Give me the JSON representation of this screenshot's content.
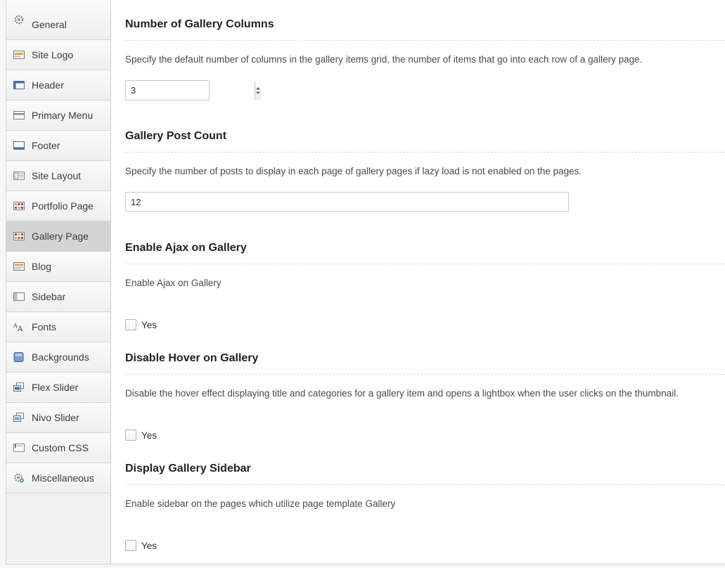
{
  "sidebar": {
    "items": [
      {
        "label": "General",
        "icon": "gear-icon"
      },
      {
        "label": "Site Logo",
        "icon": "logo-icon"
      },
      {
        "label": "Header",
        "icon": "header-icon"
      },
      {
        "label": "Primary Menu",
        "icon": "menu-icon"
      },
      {
        "label": "Footer",
        "icon": "footer-icon"
      },
      {
        "label": "Site Layout",
        "icon": "layout-icon"
      },
      {
        "label": "Portfolio Page",
        "icon": "portfolio-icon"
      },
      {
        "label": "Gallery Page",
        "icon": "gallery-icon",
        "active": true
      },
      {
        "label": "Blog",
        "icon": "blog-icon"
      },
      {
        "label": "Sidebar",
        "icon": "sidebar-icon"
      },
      {
        "label": "Fonts",
        "icon": "fonts-icon"
      },
      {
        "label": "Backgrounds",
        "icon": "backgrounds-icon"
      },
      {
        "label": "Flex Slider",
        "icon": "slider-icon"
      },
      {
        "label": "Nivo Slider",
        "icon": "slider-icon"
      },
      {
        "label": "Custom CSS",
        "icon": "css-icon"
      },
      {
        "label": "Miscellaneous",
        "icon": "misc-icon"
      }
    ]
  },
  "sections": {
    "columns": {
      "title": "Number of Gallery Columns",
      "description": "Specify the default number of columns in the gallery items grid, the number of items that go into each row of a gallery page.",
      "value": "3"
    },
    "post_count": {
      "title": "Gallery Post Count",
      "description": "Specify the number of posts to display in each page of gallery pages if lazy load is not enabled on the pages.",
      "value": "12"
    },
    "ajax": {
      "title": "Enable Ajax on Gallery",
      "description": "Enable Ajax on Gallery",
      "checkbox_label": "Yes",
      "checked": false
    },
    "hover": {
      "title": "Disable Hover on Gallery",
      "description": "Disable the hover effect displaying title and categories for a gallery item and opens a lightbox when the user clicks on the thumbnail.",
      "checkbox_label": "Yes",
      "checked": false
    },
    "sidebar": {
      "title": "Display Gallery Sidebar",
      "description": "Enable sidebar on the pages which utilize page template Gallery",
      "checkbox_label": "Yes",
      "checked": false
    }
  }
}
